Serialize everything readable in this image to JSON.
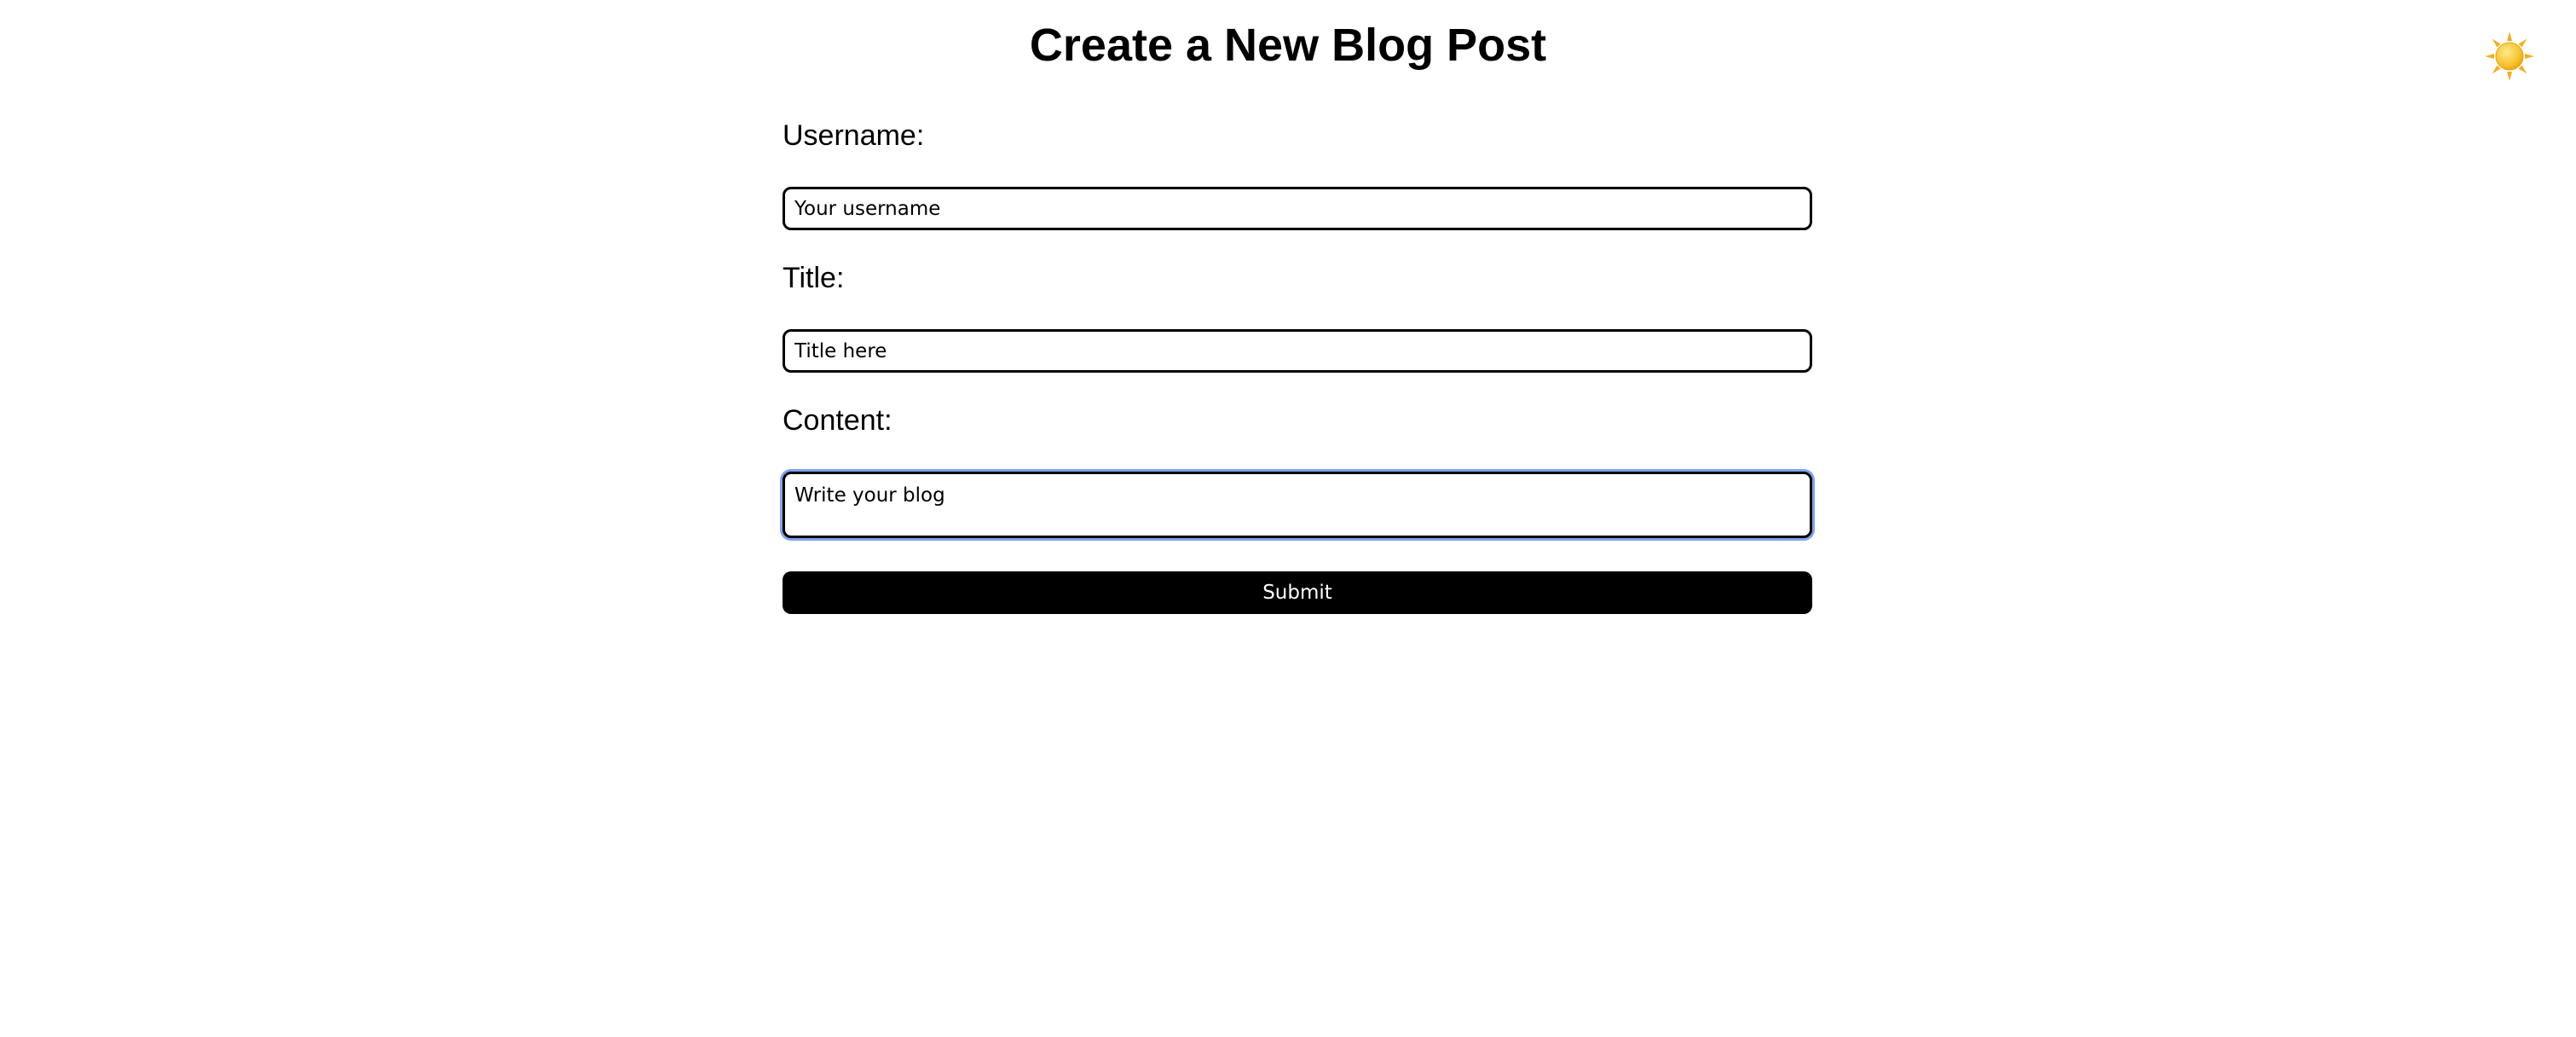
{
  "page": {
    "title": "Create a New Blog Post"
  },
  "theme_toggle": {
    "icon": "sun-icon",
    "color": "#f4b400"
  },
  "form": {
    "username": {
      "label": "Username:",
      "placeholder": "Your username",
      "value": ""
    },
    "title": {
      "label": "Title:",
      "placeholder": "Title here",
      "value": ""
    },
    "content": {
      "label": "Content:",
      "placeholder": "Write your blog",
      "value": "",
      "focused": true,
      "focus_ring_color": "#7fa2ef"
    },
    "submit_label": "Submit",
    "submit_color": "#000000"
  }
}
